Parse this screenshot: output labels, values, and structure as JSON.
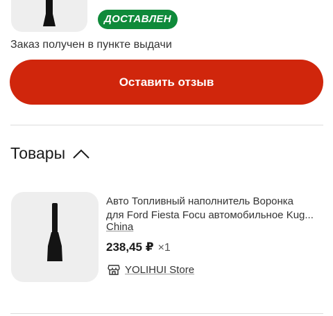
{
  "order": {
    "status_badge": "ДОСТАВЛЕН",
    "status_text": "Заказ получен в пункте выдачи",
    "review_button_label": "Оставить отзыв"
  },
  "products_section": {
    "title": "Товары",
    "collapse_icon": "chevron-up-icon"
  },
  "product": {
    "title_line_1": "Авто Топливный наполнитель Воронка",
    "title_line_2": "для Ford Fiesta Focu автомобильное Kug...",
    "origin": "China",
    "price": "238,45 ₽",
    "quantity": "×1",
    "store_icon": "store-icon",
    "store_name": "YOLIHUI Store",
    "image_icon": "funnel-image"
  },
  "colors": {
    "badge_bg": "#0f8a3a",
    "button_bg": "#d0260c",
    "thumb_bg": "#eeeeee"
  }
}
